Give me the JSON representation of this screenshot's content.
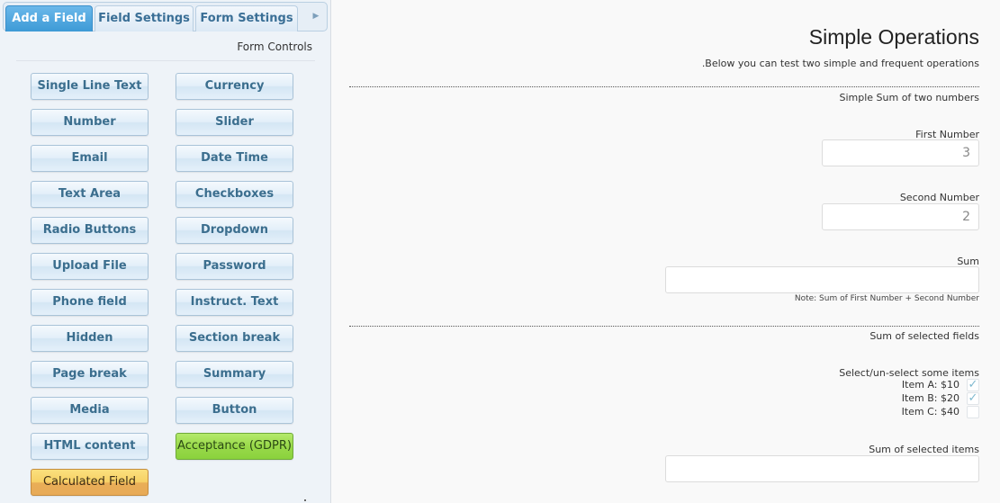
{
  "tabs": [
    {
      "label": "Add a Field",
      "active": true
    },
    {
      "label": "Field Settings",
      "active": false
    },
    {
      "label": "Form Settings",
      "active": false
    }
  ],
  "tab_scroll_icon": "chevron-right-icon",
  "section_title": "Form Controls",
  "controls": [
    {
      "label": "Single Line Text"
    },
    {
      "label": "Currency"
    },
    {
      "label": "Number"
    },
    {
      "label": "Slider"
    },
    {
      "label": "Email"
    },
    {
      "label": "Date Time"
    },
    {
      "label": "Text Area"
    },
    {
      "label": "Checkboxes"
    },
    {
      "label": "Radio Buttons"
    },
    {
      "label": "Dropdown"
    },
    {
      "label": "Upload File"
    },
    {
      "label": "Password"
    },
    {
      "label": "Phone field"
    },
    {
      "label": "Instruct. Text"
    },
    {
      "label": "Hidden"
    },
    {
      "label": "Section break"
    },
    {
      "label": "Page break"
    },
    {
      "label": "Summary"
    },
    {
      "label": "Media"
    },
    {
      "label": "Button"
    },
    {
      "label": "HTML content"
    },
    {
      "label": "Acceptance (GDPR)"
    },
    {
      "label": "Calculated Field"
    }
  ],
  "form": {
    "title": "Simple Operations",
    "description": ".Below you can test two simple and frequent operations",
    "section1": {
      "title": "Simple Sum of two numbers",
      "first_label": "First Number",
      "first_value": "3",
      "second_label": "Second Number",
      "second_value": "2",
      "sum_label": "Sum",
      "sum_value": "",
      "note": "Note: Sum of First Number + Second Number"
    },
    "section2": {
      "title": "Sum of selected fields",
      "checkbox_label": "Select/un-select some items",
      "items": [
        {
          "label": "Item A: $10",
          "checked": true
        },
        {
          "label": "Item B: $20",
          "checked": true
        },
        {
          "label": "Item C: $40",
          "checked": false
        }
      ],
      "sum_label": "Sum of selected items",
      "sum_value": ""
    }
  }
}
